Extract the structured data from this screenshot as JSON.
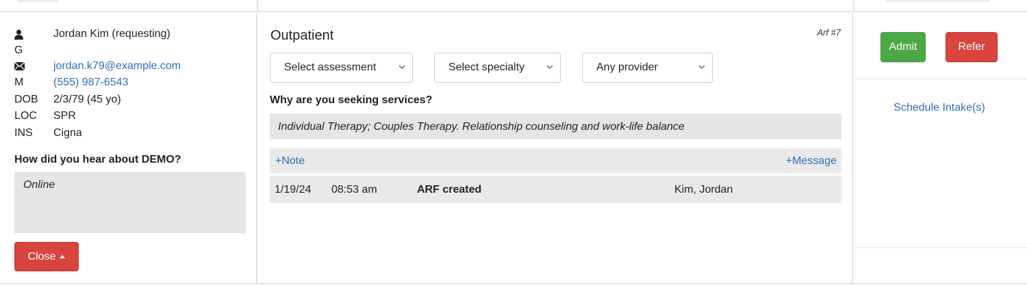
{
  "contact": {
    "name": "Jordan Kim (requesting)",
    "gender_key": "G",
    "email": "jordan.k79@example.com",
    "phone_key": "M",
    "phone": "(555) 987-6543",
    "dob_key": "DOB",
    "dob": "2/3/79 (45 yo)",
    "loc_key": "LOC",
    "loc": "SPR",
    "ins_key": "INS",
    "ins": "Cigna"
  },
  "hear": {
    "label": "How did you hear about DEMO?",
    "value": "Online"
  },
  "close_button": "Close",
  "main": {
    "title": "Outpatient",
    "arf_number": "Arf #7",
    "selects": {
      "assessment": "Select assessment",
      "specialty": "Select specialty",
      "provider": "Any provider"
    },
    "why_label": "Why are you seeking services?",
    "why_value": "Individual Therapy; Couples Therapy. Relationship counseling and work-life balance",
    "add_note": "+Note",
    "add_message": "+Message",
    "log": [
      {
        "date": "1/19/24",
        "time": "08:53 am",
        "event": "ARF created",
        "user": "Kim, Jordan"
      }
    ]
  },
  "actions": {
    "admit": "Admit",
    "refer": "Refer",
    "schedule": "Schedule Intake(s)"
  },
  "colors": {
    "link": "#2b6fb6",
    "danger": "#d9443f",
    "success": "#4aa945",
    "panel_bg": "#e5e5e5"
  },
  "icons": [
    "person-icon",
    "envelope-icon",
    "chevron-down-icon",
    "caret-up-icon"
  ]
}
